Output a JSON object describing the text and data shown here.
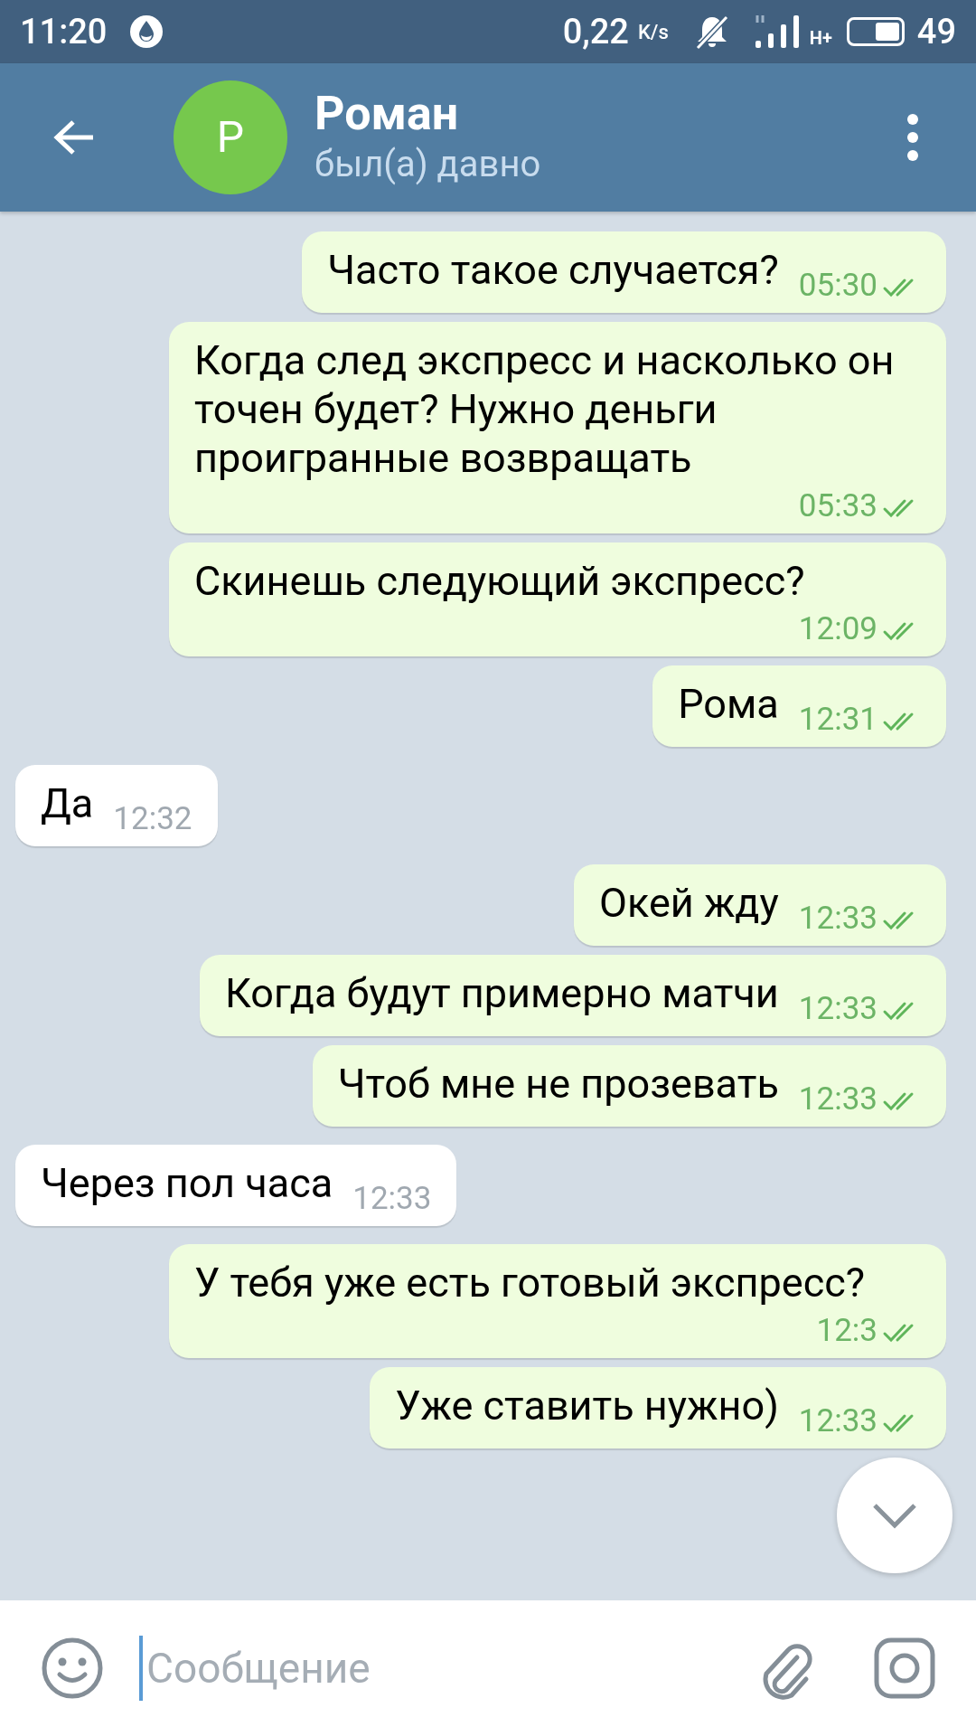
{
  "status_bar": {
    "time": "11:20",
    "speed": "0,22",
    "speed_unit": "K/s",
    "network": "H+",
    "battery": "49"
  },
  "header": {
    "avatar_letter": "Р",
    "name": "Роман",
    "status": "был(а) давно"
  },
  "messages": [
    {
      "kind": "outgoing",
      "text": "Часто такое случается?",
      "time": "05:30",
      "read": true
    },
    {
      "kind": "outgoing",
      "text": "Когда след экспресс и насколько он точен будет? Нужно деньги проигранные возвращать",
      "time": "05:33",
      "read": true
    },
    {
      "kind": "outgoing",
      "text": "Скинешь следующий экспресс?",
      "time": "12:09",
      "read": true
    },
    {
      "kind": "outgoing",
      "text": "Рома",
      "time": "12:31",
      "read": true
    },
    {
      "kind": "incoming",
      "text": "Да",
      "time": "12:32"
    },
    {
      "kind": "outgoing",
      "text": "Окей жду",
      "time": "12:33",
      "read": true
    },
    {
      "kind": "outgoing",
      "text": "Когда будут примерно матчи",
      "time": "12:33",
      "read": true
    },
    {
      "kind": "outgoing",
      "text": "Чтоб мне не прозевать",
      "time": "12:33",
      "read": true
    },
    {
      "kind": "incoming",
      "text": "Через пол часа",
      "time": "12:33"
    },
    {
      "kind": "outgoing",
      "text": "У тебя уже есть готовый экспресс?",
      "time": "12:3",
      "read": true
    },
    {
      "kind": "outgoing",
      "text": "Уже ставить нужно)",
      "time": "12:33",
      "read": true
    }
  ],
  "composer": {
    "placeholder": "Сообщение"
  }
}
